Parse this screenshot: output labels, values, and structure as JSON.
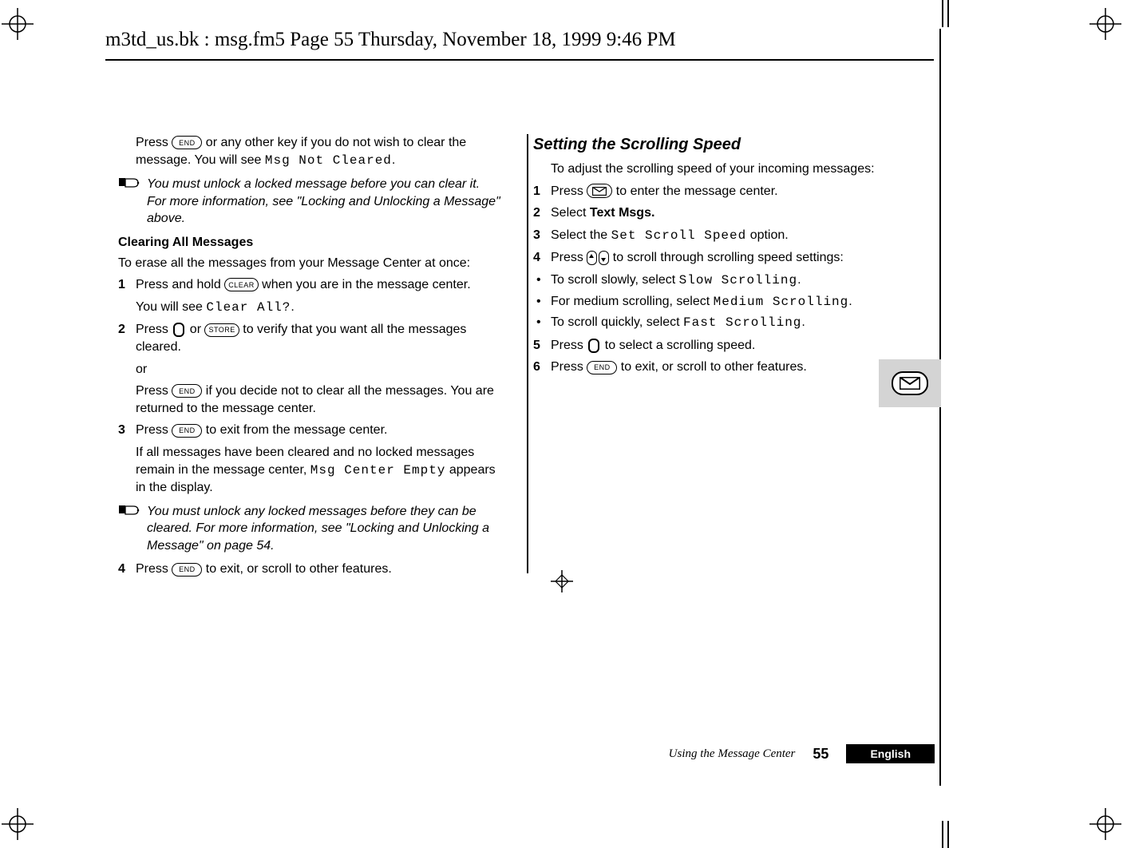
{
  "header": {
    "running_head": "m3td_us.bk : msg.fm5  Page 55  Thursday, November 18, 1999  9:46 PM"
  },
  "icons": {
    "end_key": "END",
    "clear_key": "CLEAR",
    "store_key": "STORE",
    "envelope": "✉",
    "note_hand": "☞"
  },
  "left": {
    "p1a": "Press ",
    "p1b": " or any other key if you do not wish to clear the message. You will see ",
    "p1_mono": "Msg Not Cleared",
    "p1c": ".",
    "note1": "You must unlock a locked message before you can clear it. For more information, see \"Locking and Unlocking a Message\"  above.",
    "subhead": "Clearing All Messages",
    "intro": "To erase all the messages from your Message Center at once:",
    "s1a": "Press and hold ",
    "s1b": " when you are in the message center.",
    "s1c_pre": "You will see ",
    "s1c_mono": "Clear All?",
    "s1c_post": ".",
    "s2a": "Press ",
    "s2b": " or ",
    "s2c": " to verify that you want all the messages cleared.",
    "or": "or",
    "s2d": "Press ",
    "s2e": " if you decide not to clear all the messages. You are returned to the message center.",
    "s3a": "Press ",
    "s3b": " to exit from the message center.",
    "s3c_pre": "If all messages have been cleared and no locked messages remain in the message center, ",
    "s3c_mono": "Msg Center Empty",
    "s3c_post": " appears in the display.",
    "note2": "You must unlock any locked messages before they can be cleared. For more information, see \"Locking and Unlocking a Message\" on page 54.",
    "s4a": "Press ",
    "s4b": " to exit, or scroll to other features."
  },
  "right": {
    "heading": "Setting the Scrolling Speed",
    "intro": "To adjust the scrolling speed of your incoming messages:",
    "s1a": "Press ",
    "s1b": " to enter the message center.",
    "s2a": "Select ",
    "s2b": "Text Msgs.",
    "s3a": "Select the ",
    "s3_mono": "Set Scroll Speed",
    "s3b": " option.",
    "s4a": "Press ",
    "s4b": " to scroll through scrolling speed settings:",
    "b1a": "To scroll slowly, select ",
    "b1_mono": "Slow Scrolling",
    "b1b": ".",
    "b2a": "For medium scrolling, select ",
    "b2_mono": "Medium Scrolling",
    "b2b": ".",
    "b3a": "To scroll quickly, select ",
    "b3_mono": "Fast Scrolling",
    "b3b": ".",
    "s5a": "Press ",
    "s5b": " to select a scrolling speed.",
    "s6a": "Press ",
    "s6b": " to exit, or scroll to other features."
  },
  "footer": {
    "section": "Using the Message Center",
    "page": "55",
    "lang": "English"
  }
}
